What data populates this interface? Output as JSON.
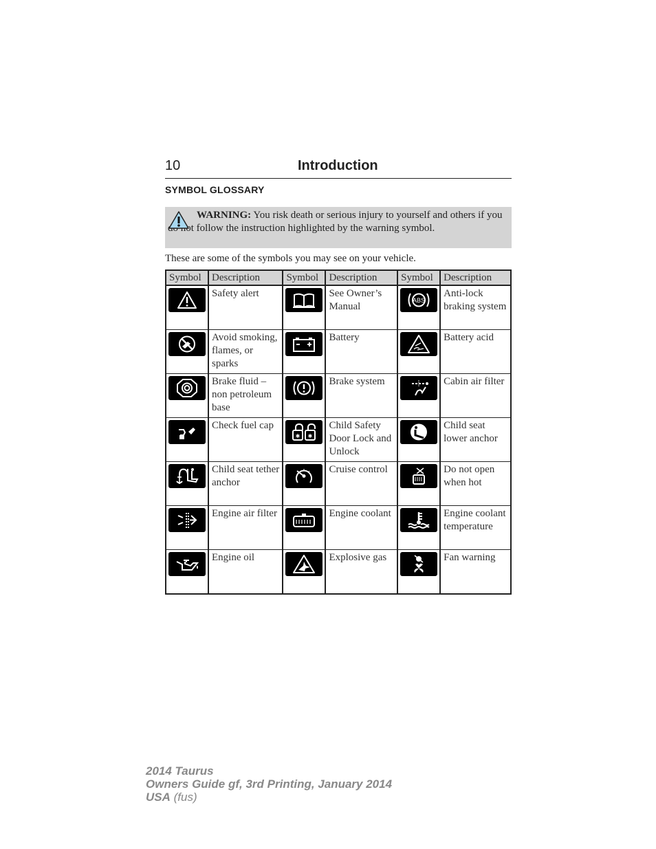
{
  "header": {
    "page_number": "10",
    "title": "Introduction"
  },
  "section_title": "SYMBOL GLOSSARY",
  "warning": {
    "icon": "warning-triangle-icon",
    "icon_color": "#a8d8f0",
    "label": "WARNING:",
    "text": " You risk death or serious injury to yourself and others if you do not follow the instruction highlighted by the warning symbol."
  },
  "intro": "These are some of the symbols you may see on your vehicle.",
  "table": {
    "headers": [
      "Symbol",
      "Description",
      "Symbol",
      "Description",
      "Symbol",
      "Description"
    ],
    "rows": [
      [
        {
          "icon": "safety-alert-icon",
          "label": "Safety alert"
        },
        {
          "icon": "owners-manual-icon",
          "label": "See Owner’s Manual"
        },
        {
          "icon": "abs-icon",
          "label": "Anti-lock braking system"
        }
      ],
      [
        {
          "icon": "no-smoking-icon",
          "label": "Avoid smoking, flames, or sparks"
        },
        {
          "icon": "battery-icon",
          "label": "Battery"
        },
        {
          "icon": "battery-acid-icon",
          "label": "Battery acid"
        }
      ],
      [
        {
          "icon": "brake-fluid-icon",
          "label": "Brake fluid – non petroleum base"
        },
        {
          "icon": "brake-system-icon",
          "label": "Brake system"
        },
        {
          "icon": "cabin-air-filter-icon",
          "label": "Cabin air filter"
        }
      ],
      [
        {
          "icon": "fuel-cap-icon",
          "label": "Check fuel cap"
        },
        {
          "icon": "child-safety-lock-icon",
          "label": "Child Safety Door Lock and Unlock"
        },
        {
          "icon": "child-seat-lower-anchor-icon",
          "label": "Child seat lower anchor"
        }
      ],
      [
        {
          "icon": "child-seat-tether-icon",
          "label": "Child seat tether anchor"
        },
        {
          "icon": "cruise-control-icon",
          "label": "Cruise control"
        },
        {
          "icon": "do-not-open-hot-icon",
          "label": "Do not open when hot"
        }
      ],
      [
        {
          "icon": "engine-air-filter-icon",
          "label": "Engine air filter"
        },
        {
          "icon": "engine-coolant-icon",
          "label": "Engine coolant"
        },
        {
          "icon": "coolant-temperature-icon",
          "label": "Engine coolant temperature"
        }
      ],
      [
        {
          "icon": "engine-oil-icon",
          "label": "Engine oil"
        },
        {
          "icon": "explosive-gas-icon",
          "label": "Explosive gas"
        },
        {
          "icon": "fan-warning-icon",
          "label": "Fan warning"
        }
      ]
    ]
  },
  "footer": {
    "line1": "2014 Taurus",
    "line2": "Owners Guide gf, 3rd Printing, January 2014",
    "line3_bold": "USA",
    "line3_light": " (fus)"
  }
}
